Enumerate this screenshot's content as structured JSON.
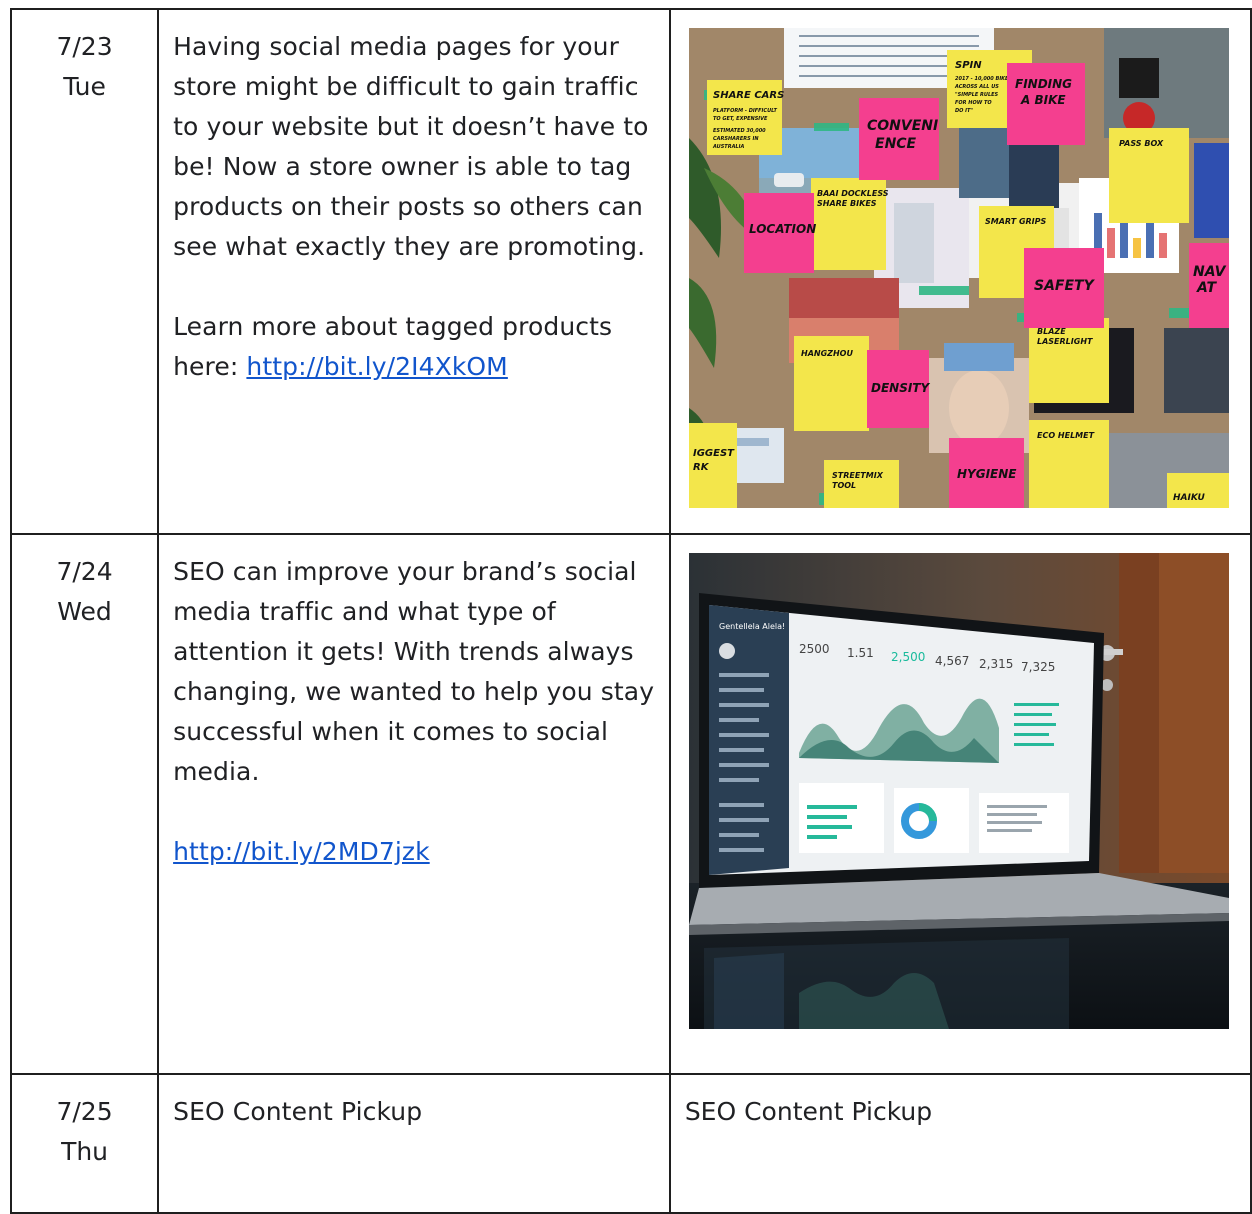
{
  "rows": [
    {
      "date": "7/23",
      "day": "Tue",
      "paragraph": "Having social media pages for your store might be difficult to gain traffic to your website but it doesn’t have to be! Now a store owner is able to tag products on their posts so others can see what exactly they are promoting.",
      "learn_more_prefix": "Learn more about tagged products here: ",
      "link": "http://bit.ly/2I4XkOM",
      "image": {
        "notes": {
          "sharecars": "SHARE CARS",
          "sharecars_sub1": "PLATFORM - DIFFICULT",
          "sharecars_sub2": "TO GET, EXPENSIVE",
          "sharecars_sub3": "ESTIMATED 30,000",
          "sharecars_sub4": "CARSHARERS IN",
          "sharecars_sub5": "AUSTRALIA",
          "spin": "SPIN",
          "spin_sub1": "2017 - 10,000 BIKES",
          "spin_sub2": "ACROSS ALL US",
          "spin_sub3": "\"SIMPLE RULES",
          "spin_sub4": "FOR HOW TO",
          "spin_sub5": "DO IT\"",
          "finding": "FINDING",
          "abike": "A BIKE",
          "conv1": "CONVENI",
          "conv2": "ENCE",
          "passbox": "PASS BOX",
          "baai1": "BAAI DOCKLESS",
          "baai2": "SHARE BIKES",
          "smartgrips": "SMART GRIPS",
          "location": "LOCATION",
          "safety": "SAFETY",
          "nav1": "NAV",
          "nav2": "AT",
          "hangzhou": "HANGZHOU",
          "density": "DENSITY",
          "blaze1": "BLAZE",
          "blaze2": "LASERLIGHT",
          "ecohelmet": "ECO HELMET",
          "hygiene": "HYGIENE",
          "streetmix1": "STREETMIX",
          "streetmix2": "TOOL",
          "biggest1": "IGGEST",
          "biggest2": "RK",
          "haiku": "HAIKU"
        }
      }
    },
    {
      "date": "7/24",
      "day": "Wed",
      "paragraph": "SEO can improve your brand’s social media traffic and what type of attention it gets! With trends always changing, we wanted to help you stay successful when it comes to social media.",
      "link": "http://bit.ly/2MD7jzk",
      "image": {
        "dashboard_title": "Gentellela Alela!",
        "stats": [
          "2500",
          "1.51",
          "2,500",
          "4,567",
          "2,315",
          "7,325"
        ]
      }
    },
    {
      "date": "7/25",
      "day": "Thu",
      "col2": "SEO Content Pickup",
      "col3": "SEO Content Pickup"
    }
  ]
}
